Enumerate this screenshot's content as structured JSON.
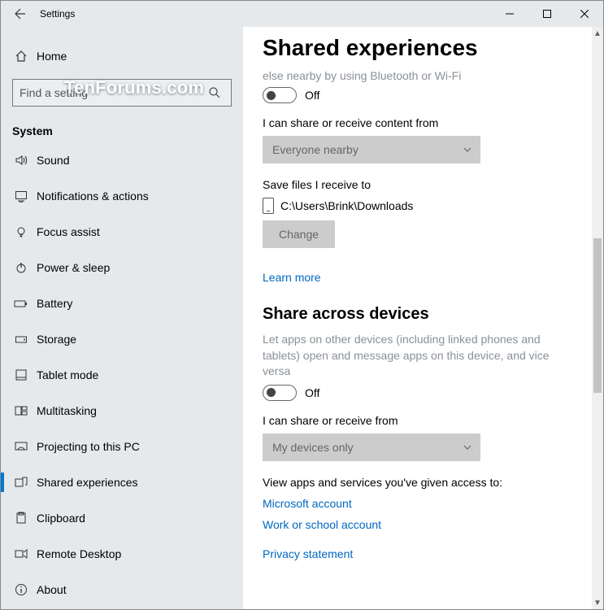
{
  "titlebar": {
    "title": "Settings"
  },
  "watermark": "TenForums.com",
  "sidebar": {
    "home": "Home",
    "search_placeholder": "Find a setting",
    "group": "System",
    "items": [
      {
        "label": "Sound"
      },
      {
        "label": "Notifications & actions"
      },
      {
        "label": "Focus assist"
      },
      {
        "label": "Power & sleep"
      },
      {
        "label": "Battery"
      },
      {
        "label": "Storage"
      },
      {
        "label": "Tablet mode"
      },
      {
        "label": "Multitasking"
      },
      {
        "label": "Projecting to this PC"
      },
      {
        "label": "Shared experiences"
      },
      {
        "label": "Clipboard"
      },
      {
        "label": "Remote Desktop"
      },
      {
        "label": "About"
      }
    ]
  },
  "main": {
    "heading": "Shared experiences",
    "cut_text": "else nearby by using Bluetooth or Wi-Fi",
    "toggle1_state": "Off",
    "share_from_label": "I can share or receive content from",
    "share_from_value": "Everyone nearby",
    "save_label": "Save files I receive to",
    "save_path": "C:\\Users\\Brink\\Downloads",
    "change_btn": "Change",
    "learn_more": "Learn more",
    "section2": "Share across devices",
    "section2_desc": "Let apps on other devices (including linked phones and tablets) open and message apps on this device, and vice versa",
    "toggle2_state": "Off",
    "share_from2_label": "I can share or receive from",
    "share_from2_value": "My devices only",
    "view_apps": "View apps and services you've given access to:",
    "ms_account": "Microsoft account",
    "work_account": "Work or school account",
    "privacy": "Privacy statement"
  }
}
